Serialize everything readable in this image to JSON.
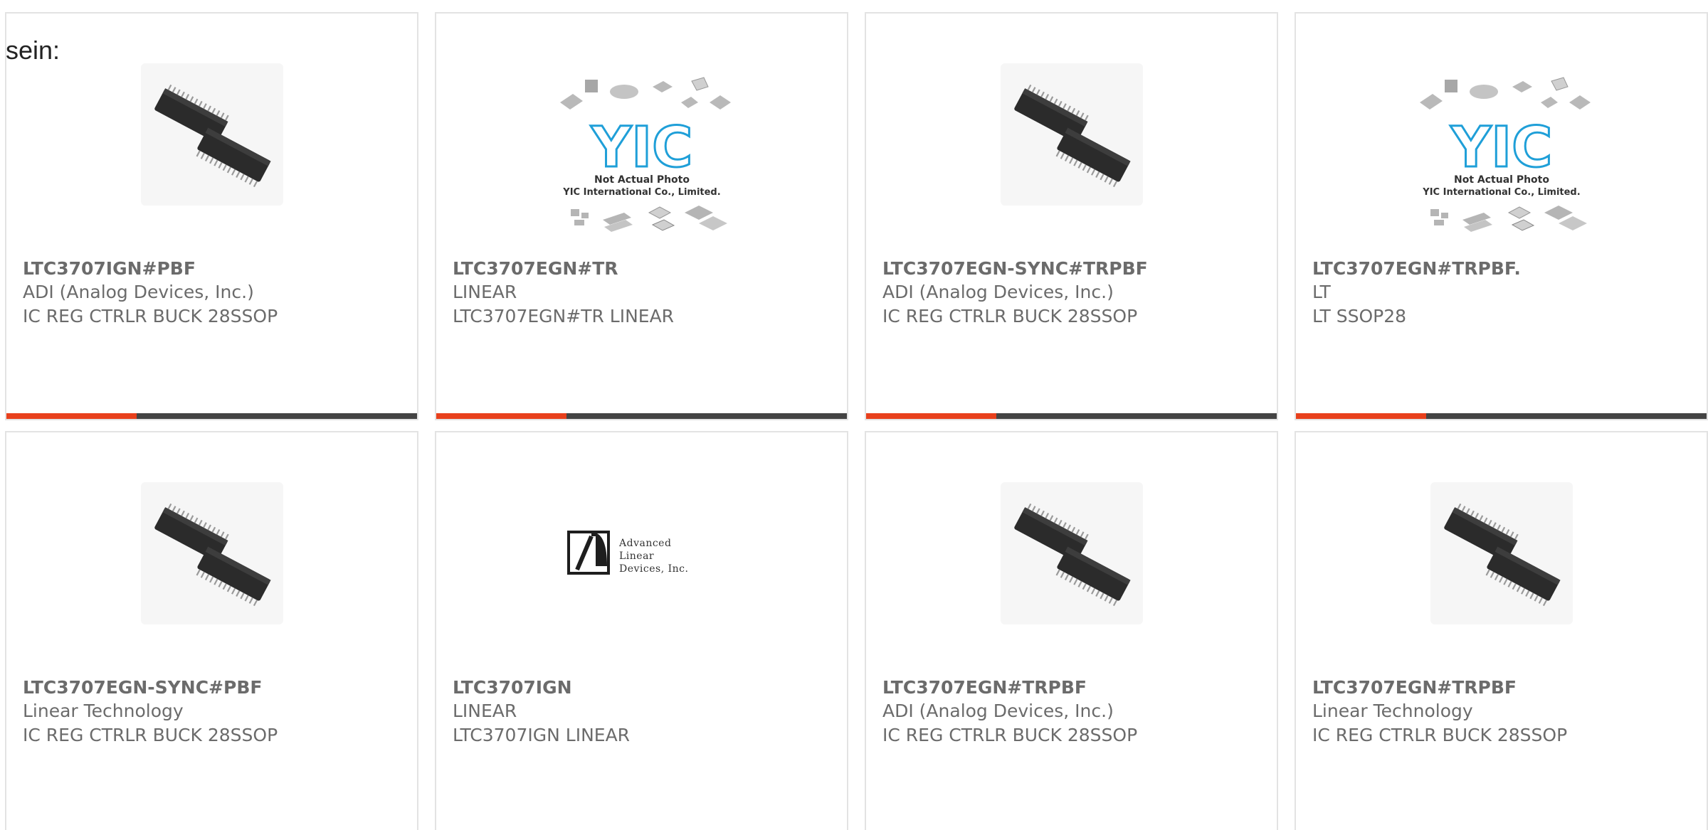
{
  "lead_text": "sein:",
  "colors": {
    "accent": "#e8401c",
    "bar": "#444444",
    "border": "#e3e3e3",
    "yic_logo": "#1f9fd8"
  },
  "products": [
    {
      "part": "LTC3707IGN#PBF",
      "manufacturer": "ADI (Analog Devices, Inc.)",
      "description": "IC REG CTRLR BUCK 28SSOP",
      "image": "ic-chip-photo"
    },
    {
      "part": "LTC3707EGN#TR",
      "manufacturer": "LINEAR",
      "description": "LTC3707EGN#TR LINEAR",
      "image": "yic-placeholder",
      "image_text": {
        "logo": "YIC",
        "line1": "Not Actual Photo",
        "line2": "YIC International Co., Limited."
      }
    },
    {
      "part": "LTC3707EGN-SYNC#TRPBF",
      "manufacturer": "ADI (Analog Devices, Inc.)",
      "description": "IC REG CTRLR BUCK 28SSOP",
      "image": "ic-chip-photo"
    },
    {
      "part": "LTC3707EGN#TRPBF.",
      "manufacturer": "LT",
      "description": "LT SSOP28",
      "image": "yic-placeholder",
      "image_text": {
        "logo": "YIC",
        "line1": "Not Actual Photo",
        "line2": "YIC International Co., Limited."
      }
    },
    {
      "part": "LTC3707EGN-SYNC#PBF",
      "manufacturer": "Linear Technology",
      "description": "IC REG CTRLR BUCK 28SSOP",
      "image": "ic-chip-photo"
    },
    {
      "part": "LTC3707IGN",
      "manufacturer": "LINEAR",
      "description": "LTC3707IGN LINEAR",
      "image": "ald-logo",
      "image_text": {
        "line1": "Advanced",
        "line2": "Linear",
        "line3": "Devices, Inc."
      }
    },
    {
      "part": "LTC3707EGN#TRPBF",
      "manufacturer": "ADI (Analog Devices, Inc.)",
      "description": "IC REG CTRLR BUCK 28SSOP",
      "image": "ic-chip-photo"
    },
    {
      "part": "LTC3707EGN#TRPBF",
      "manufacturer": "Linear Technology",
      "description": "IC REG CTRLR BUCK 28SSOP",
      "image": "ic-chip-photo"
    }
  ]
}
